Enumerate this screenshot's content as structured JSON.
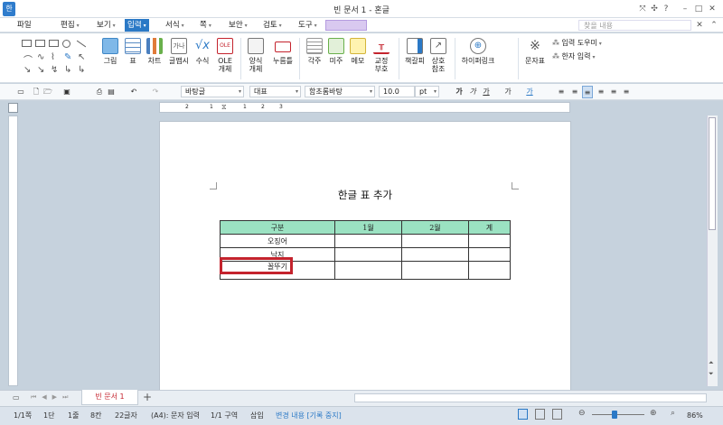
{
  "window": {
    "title": "빈 문서 1 - 혼글",
    "app_icon": "한"
  },
  "menus": [
    {
      "id": "file",
      "label": "파일",
      "arrow": false
    },
    {
      "id": "edit",
      "label": "편집",
      "arrow": true
    },
    {
      "id": "view",
      "label": "보기",
      "arrow": true
    },
    {
      "id": "input",
      "label": "입력",
      "arrow": true,
      "active": true
    },
    {
      "id": "format",
      "label": "서식",
      "arrow": true
    },
    {
      "id": "page",
      "label": "쪽",
      "arrow": true
    },
    {
      "id": "security",
      "label": "보안",
      "arrow": true
    },
    {
      "id": "review",
      "label": "검토",
      "arrow": true
    },
    {
      "id": "tools",
      "label": "도구",
      "arrow": true
    }
  ],
  "menu_search": {
    "placeholder": "찾을 내용"
  },
  "ribbon": {
    "picture": "그림",
    "table": "표",
    "chart": "차트",
    "textart": "글맵시",
    "formula": "수식",
    "ole_icon": "OLE",
    "ole_line1": "OLE",
    "ole_line2": "개체",
    "form_line1": "양식",
    "form_line2": "개체",
    "pushbutton": "누름틀",
    "footnote": "각주",
    "endnote": "미주",
    "memo": "메모",
    "proof_line1": "교정",
    "proof_line2": "부호",
    "bookmark": "책갈피",
    "crossref_line1": "상호",
    "crossref_line2": "참조",
    "hyperlink": "하이퍼링크",
    "charmap": "문자표",
    "input_helper": "입력 도우미",
    "hanja_input": "한자 입력"
  },
  "toolbar": {
    "style": "바탕글",
    "lang": "대표",
    "font": "함초롬바탕",
    "size": "10.0",
    "unit": "pt",
    "bold": "가",
    "italic": "가",
    "underline": "가",
    "strike": "가",
    "color": "가"
  },
  "ruler": {
    "marks": [
      "2",
      "1",
      "1",
      "2",
      "3"
    ]
  },
  "document": {
    "title": "한글 표 추가",
    "table": {
      "headers": [
        "구분",
        "1월",
        "2월",
        "계"
      ],
      "rows": [
        [
          "오징어",
          "",
          "",
          ""
        ],
        [
          "낙지",
          "",
          "",
          ""
        ],
        [
          "꼴뚜기",
          "",
          "",
          ""
        ]
      ]
    }
  },
  "tabs": [
    {
      "label": "빈 문서 1",
      "active": true
    }
  ],
  "add_tab": "+",
  "status": {
    "page": "1/1쪽",
    "section": "1단",
    "line": "1줄",
    "col": "8칸",
    "chars": "22글자",
    "mode": "(A4): 문자 입력",
    "zone": "1/1 구역",
    "insert": "삽입",
    "track": "변경 내용",
    "track_state": "[기록 중지]",
    "zoom": "86%"
  },
  "colors": {
    "accent": "#2b79c6",
    "highlight": "#c4232d",
    "header_cell": "#9be2c2"
  }
}
